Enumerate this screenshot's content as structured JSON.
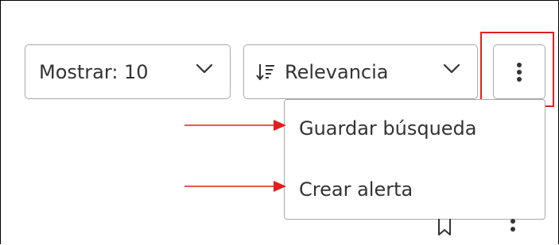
{
  "toolbar": {
    "show": {
      "label": "Mostrar: 10",
      "selected_value": "10"
    },
    "sort": {
      "label": "Relevancia"
    },
    "more_icon": "kebab-vertical-icon"
  },
  "menu": {
    "items": [
      {
        "label": "Guardar búsqueda"
      },
      {
        "label": "Crear alerta"
      }
    ]
  },
  "annotations": {
    "highlight_color": "#e31e1e",
    "arrow_color": "#e31e1e"
  },
  "result_actions": {
    "icons": [
      "bookmark-icon",
      "kebab-vertical-icon"
    ]
  }
}
